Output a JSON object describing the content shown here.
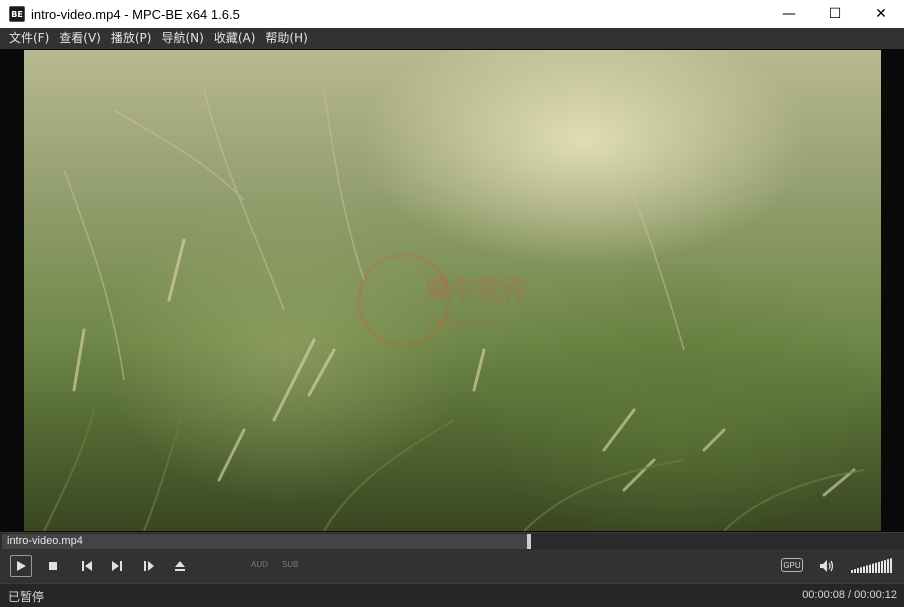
{
  "window": {
    "title": "intro-video.mp4 - MPC-BE x64 1.6.5",
    "icon_label": "BE",
    "minimize_glyph": "—",
    "maximize_glyph": "☐",
    "close_glyph": "✕"
  },
  "menu": {
    "items": [
      {
        "label": "文件(F)"
      },
      {
        "label": "查看(V)"
      },
      {
        "label": "播放(P)"
      },
      {
        "label": "导航(N)"
      },
      {
        "label": "收藏(A)"
      },
      {
        "label": "帮助(H)"
      }
    ]
  },
  "video": {
    "watermark": "犀牛软件",
    "watermark_sub": "QQMusic..."
  },
  "seek": {
    "filename": "intro-video.mp4",
    "progress": 0.6667
  },
  "toolbar": {
    "aud_label": "AUD",
    "sub_label": "SUB",
    "gpu_label": "GPU",
    "volume_level": 1.0
  },
  "status": {
    "state": "已暂停",
    "time": "00:00:08 / 00:00:12"
  },
  "colors": {
    "titlebar_bg": "#ffffff",
    "chrome_bg": "#323232",
    "status_bg": "#262626",
    "text": "#e4e4e4"
  }
}
